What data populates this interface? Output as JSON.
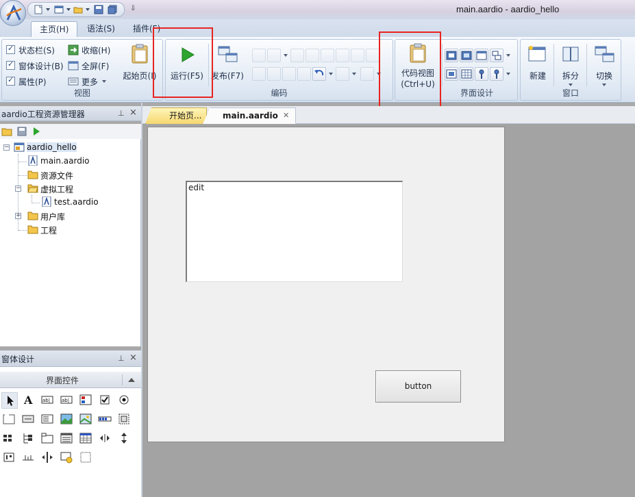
{
  "window": {
    "title": "main.aardio - aardio_hello"
  },
  "quick_access": {
    "more": "⇩"
  },
  "ribbon_tabs": [
    {
      "label": "主页(H)",
      "active": true
    },
    {
      "label": "语法(S)",
      "active": false
    },
    {
      "label": "插件(F)",
      "active": false
    }
  ],
  "view_group": {
    "label": "视图",
    "checks": [
      {
        "label": "状态栏(S)",
        "checked": true
      },
      {
        "label": "窗体设计(B)",
        "checked": true
      },
      {
        "label": "属性(P)",
        "checked": true
      }
    ],
    "collapse": "收缩(H)",
    "fullscreen": "全屏(F)",
    "more": "更多"
  },
  "start_page_button": "起始页(I)",
  "run_button": "运行(F5)",
  "publish_button": "发布(F7)",
  "code_group": {
    "label": "编码"
  },
  "code_view_button": {
    "line1": "代码视图",
    "line2": "(Ctrl+U)"
  },
  "ui_design_group": {
    "label": "界面设计"
  },
  "window_group": {
    "label": "窗口",
    "new": "新建",
    "split": "拆分",
    "switch": "切换"
  },
  "explorer": {
    "title": "aardio工程资源管理器",
    "tree": [
      {
        "label": "aardio_hello",
        "icon": "project-icon"
      },
      {
        "label": "main.aardio",
        "icon": "aardio-file-icon"
      },
      {
        "label": "资源文件",
        "icon": "folder-icon"
      },
      {
        "label": "虚拟工程",
        "icon": "folder-open-icon"
      },
      {
        "label": "test.aardio",
        "icon": "aardio-file-icon"
      },
      {
        "label": "用户库",
        "icon": "folder-icon"
      },
      {
        "label": "工程",
        "icon": "folder-icon"
      }
    ]
  },
  "design_panel": {
    "title": "窗体设计",
    "section": "界面控件"
  },
  "doc_tabs": [
    {
      "label": "开始页..."
    },
    {
      "label": "main.aardio"
    }
  ],
  "form": {
    "edit_text": "edit",
    "button_text": "button"
  },
  "colors": {
    "highlight": "#e8231f",
    "run_green": "#2ea52e",
    "accent": "#1e2e48"
  }
}
